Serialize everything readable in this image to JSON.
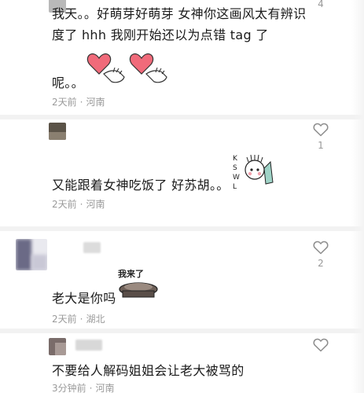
{
  "comments": [
    {
      "text": "我天。。好萌芽好萌芽 女神你这画风太有辨识度了 hhh 我刚开始还以为点错 tag 了",
      "text_tail": "呢。。",
      "time": "2天前",
      "location": "河南",
      "likes": "4"
    },
    {
      "text": "又能跟着女神吃饭了 好苏胡。。",
      "time": "2天前",
      "location": "河南",
      "likes": "1",
      "sticker_text": "KSWL"
    },
    {
      "text": "老大是你吗",
      "time": "2天前",
      "location": "湖北",
      "likes": "2",
      "sticker_text": "我来了"
    },
    {
      "text": "不要给人解码姐姐会让老大被骂的",
      "time": "3分钟前",
      "location": "河南",
      "likes": ""
    }
  ],
  "icons": {
    "like": "heart-outline-icon",
    "sticker_1": "heart-hands-sticker",
    "sticker_2": "kswl-sticker",
    "sticker_3": "pot-sticker"
  },
  "colors": {
    "heart_fill": "#f06a7a",
    "meta_text": "#9a9a9a",
    "divider": "#f2f2f2"
  }
}
